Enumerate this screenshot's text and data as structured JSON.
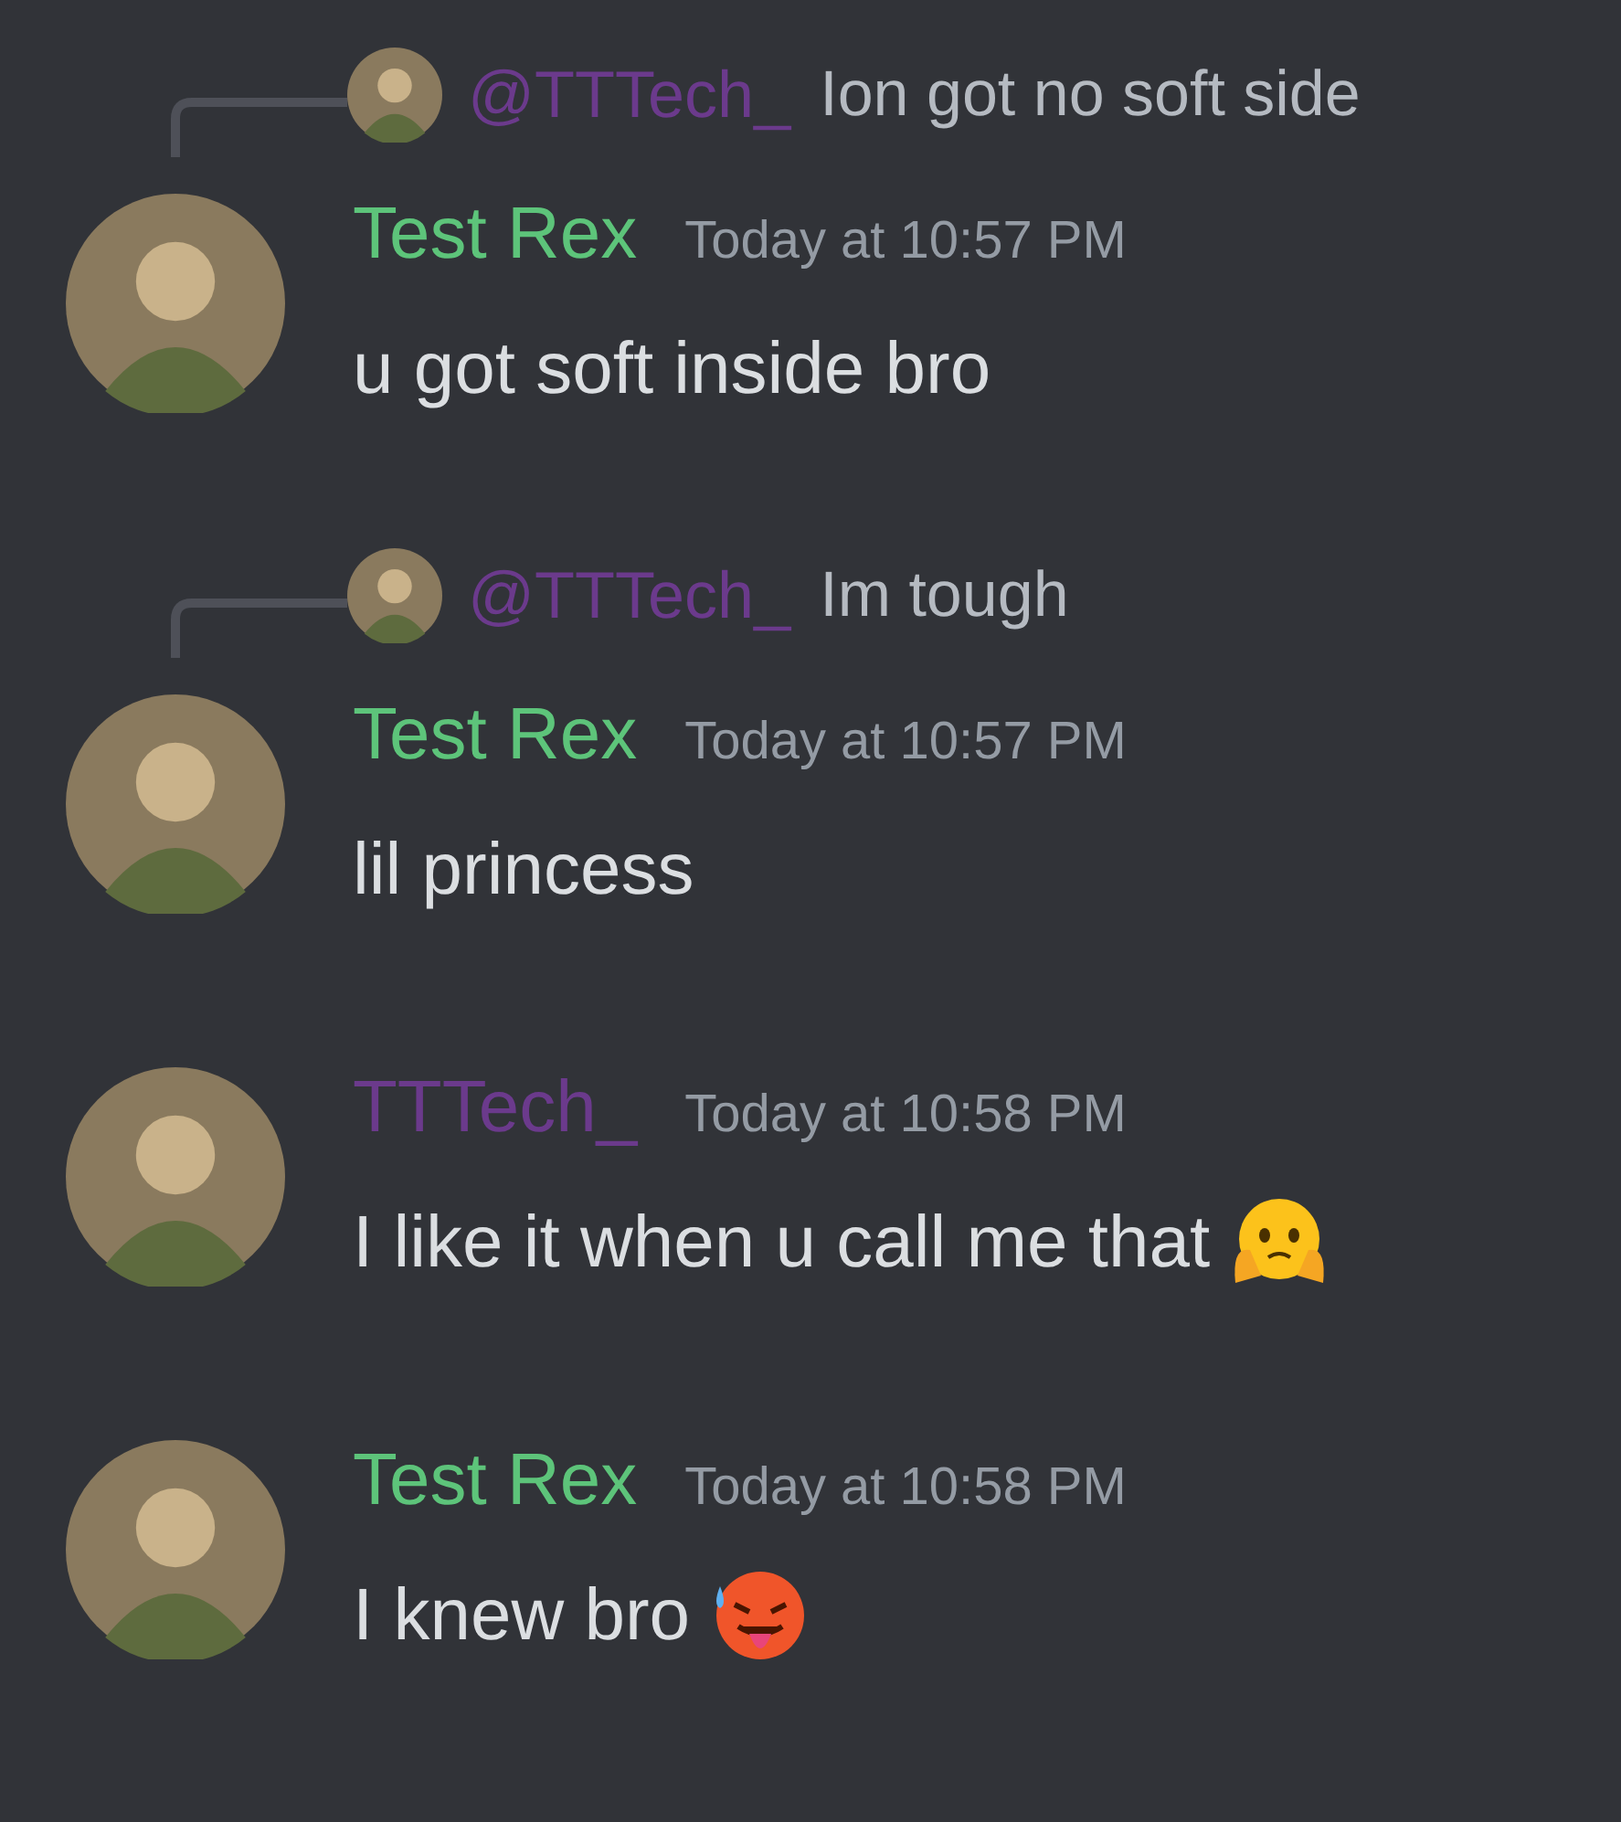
{
  "messages": [
    {
      "reply": {
        "author": "@TTTech_",
        "text": "Ion got no soft side"
      },
      "author": "Test Rex",
      "color": "#5dc47a",
      "time": "Today at 10:57 PM",
      "text": "u got soft inside bro"
    },
    {
      "reply": {
        "author": "@TTTech_",
        "text": "Im tough"
      },
      "author": "Test Rex",
      "color": "#5dc47a",
      "time": "Today at 10:57 PM",
      "text": "lil princess"
    },
    {
      "author": "TTTech_",
      "color": "#6b3a8c",
      "time": "Today at 10:58 PM",
      "text": "I like it when u call me that",
      "emoji": {
        "kind": "hands"
      }
    },
    {
      "author": "Test Rex",
      "color": "#5dc47a",
      "time": "Today at 10:58 PM",
      "text": "I knew bro",
      "emoji": {
        "kind": "hot"
      }
    }
  ]
}
